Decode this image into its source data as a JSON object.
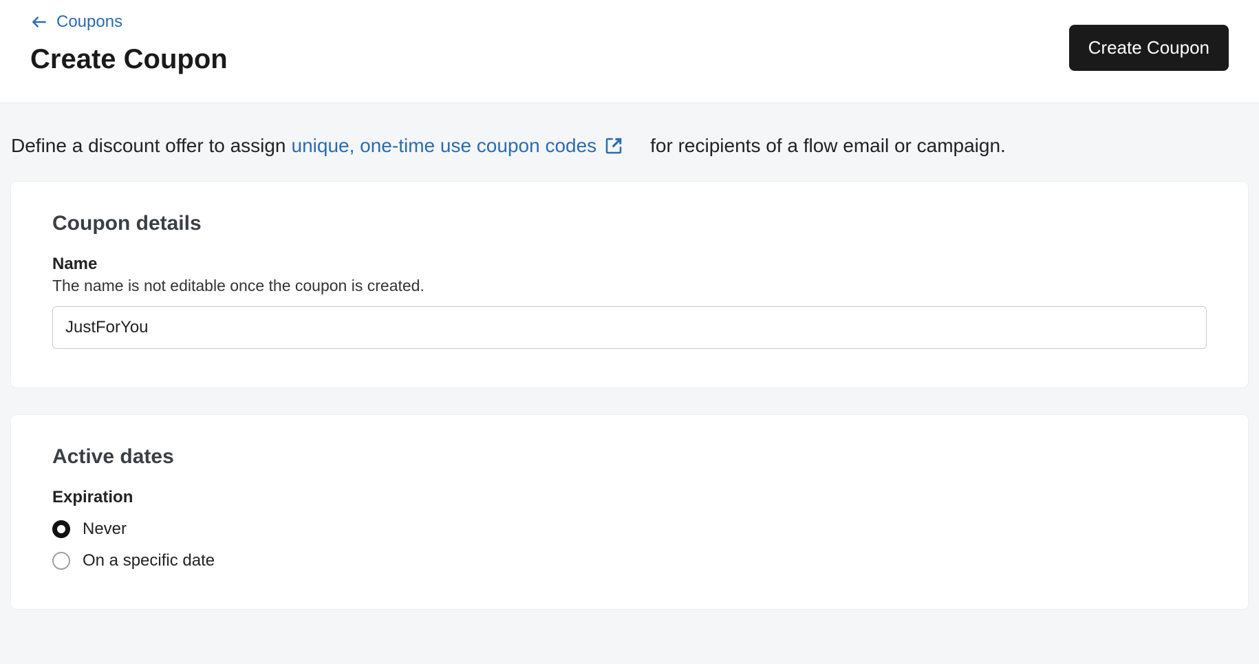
{
  "breadcrumb": {
    "label": "Coupons"
  },
  "page": {
    "title": "Create Coupon"
  },
  "actions": {
    "create_label": "Create Coupon"
  },
  "description": {
    "before": "Define a discount offer to assign",
    "link": "unique, one-time use coupon codes",
    "after": "for recipients of a flow email or campaign."
  },
  "coupon_details": {
    "section_title": "Coupon details",
    "name_label": "Name",
    "name_help": "The name is not editable once the coupon is created.",
    "name_value": "JustForYou"
  },
  "active_dates": {
    "section_title": "Active dates",
    "expiration_label": "Expiration",
    "options": {
      "never": "Never",
      "specific": "On a specific date"
    },
    "selected": "never"
  }
}
